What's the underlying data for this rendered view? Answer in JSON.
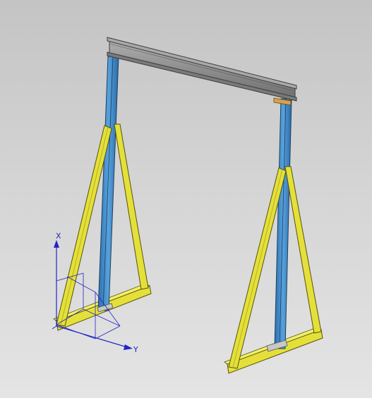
{
  "viewport": {
    "background_top": "#c4c4c4",
    "background_bottom": "#e4e4e4"
  },
  "model": {
    "beam_color": "#8e8e8e",
    "post_color": "#3a84c4",
    "brace_color": "#e4e039",
    "plate_color": "#d8a24a"
  },
  "triad": {
    "color": "#2323c8",
    "x_label": "X",
    "y_label": "Y"
  }
}
